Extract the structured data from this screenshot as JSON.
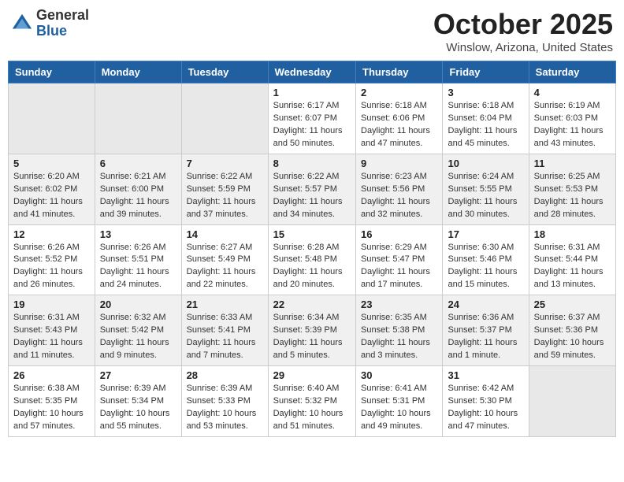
{
  "header": {
    "logo": {
      "general": "General",
      "blue": "Blue"
    },
    "title": "October 2025",
    "location": "Winslow, Arizona, United States"
  },
  "weekdays": [
    "Sunday",
    "Monday",
    "Tuesday",
    "Wednesday",
    "Thursday",
    "Friday",
    "Saturday"
  ],
  "weeks": [
    [
      {
        "day": "",
        "info": ""
      },
      {
        "day": "",
        "info": ""
      },
      {
        "day": "",
        "info": ""
      },
      {
        "day": "1",
        "info": "Sunrise: 6:17 AM\nSunset: 6:07 PM\nDaylight: 11 hours\nand 50 minutes."
      },
      {
        "day": "2",
        "info": "Sunrise: 6:18 AM\nSunset: 6:06 PM\nDaylight: 11 hours\nand 47 minutes."
      },
      {
        "day": "3",
        "info": "Sunrise: 6:18 AM\nSunset: 6:04 PM\nDaylight: 11 hours\nand 45 minutes."
      },
      {
        "day": "4",
        "info": "Sunrise: 6:19 AM\nSunset: 6:03 PM\nDaylight: 11 hours\nand 43 minutes."
      }
    ],
    [
      {
        "day": "5",
        "info": "Sunrise: 6:20 AM\nSunset: 6:02 PM\nDaylight: 11 hours\nand 41 minutes."
      },
      {
        "day": "6",
        "info": "Sunrise: 6:21 AM\nSunset: 6:00 PM\nDaylight: 11 hours\nand 39 minutes."
      },
      {
        "day": "7",
        "info": "Sunrise: 6:22 AM\nSunset: 5:59 PM\nDaylight: 11 hours\nand 37 minutes."
      },
      {
        "day": "8",
        "info": "Sunrise: 6:22 AM\nSunset: 5:57 PM\nDaylight: 11 hours\nand 34 minutes."
      },
      {
        "day": "9",
        "info": "Sunrise: 6:23 AM\nSunset: 5:56 PM\nDaylight: 11 hours\nand 32 minutes."
      },
      {
        "day": "10",
        "info": "Sunrise: 6:24 AM\nSunset: 5:55 PM\nDaylight: 11 hours\nand 30 minutes."
      },
      {
        "day": "11",
        "info": "Sunrise: 6:25 AM\nSunset: 5:53 PM\nDaylight: 11 hours\nand 28 minutes."
      }
    ],
    [
      {
        "day": "12",
        "info": "Sunrise: 6:26 AM\nSunset: 5:52 PM\nDaylight: 11 hours\nand 26 minutes."
      },
      {
        "day": "13",
        "info": "Sunrise: 6:26 AM\nSunset: 5:51 PM\nDaylight: 11 hours\nand 24 minutes."
      },
      {
        "day": "14",
        "info": "Sunrise: 6:27 AM\nSunset: 5:49 PM\nDaylight: 11 hours\nand 22 minutes."
      },
      {
        "day": "15",
        "info": "Sunrise: 6:28 AM\nSunset: 5:48 PM\nDaylight: 11 hours\nand 20 minutes."
      },
      {
        "day": "16",
        "info": "Sunrise: 6:29 AM\nSunset: 5:47 PM\nDaylight: 11 hours\nand 17 minutes."
      },
      {
        "day": "17",
        "info": "Sunrise: 6:30 AM\nSunset: 5:46 PM\nDaylight: 11 hours\nand 15 minutes."
      },
      {
        "day": "18",
        "info": "Sunrise: 6:31 AM\nSunset: 5:44 PM\nDaylight: 11 hours\nand 13 minutes."
      }
    ],
    [
      {
        "day": "19",
        "info": "Sunrise: 6:31 AM\nSunset: 5:43 PM\nDaylight: 11 hours\nand 11 minutes."
      },
      {
        "day": "20",
        "info": "Sunrise: 6:32 AM\nSunset: 5:42 PM\nDaylight: 11 hours\nand 9 minutes."
      },
      {
        "day": "21",
        "info": "Sunrise: 6:33 AM\nSunset: 5:41 PM\nDaylight: 11 hours\nand 7 minutes."
      },
      {
        "day": "22",
        "info": "Sunrise: 6:34 AM\nSunset: 5:39 PM\nDaylight: 11 hours\nand 5 minutes."
      },
      {
        "day": "23",
        "info": "Sunrise: 6:35 AM\nSunset: 5:38 PM\nDaylight: 11 hours\nand 3 minutes."
      },
      {
        "day": "24",
        "info": "Sunrise: 6:36 AM\nSunset: 5:37 PM\nDaylight: 11 hours\nand 1 minute."
      },
      {
        "day": "25",
        "info": "Sunrise: 6:37 AM\nSunset: 5:36 PM\nDaylight: 10 hours\nand 59 minutes."
      }
    ],
    [
      {
        "day": "26",
        "info": "Sunrise: 6:38 AM\nSunset: 5:35 PM\nDaylight: 10 hours\nand 57 minutes."
      },
      {
        "day": "27",
        "info": "Sunrise: 6:39 AM\nSunset: 5:34 PM\nDaylight: 10 hours\nand 55 minutes."
      },
      {
        "day": "28",
        "info": "Sunrise: 6:39 AM\nSunset: 5:33 PM\nDaylight: 10 hours\nand 53 minutes."
      },
      {
        "day": "29",
        "info": "Sunrise: 6:40 AM\nSunset: 5:32 PM\nDaylight: 10 hours\nand 51 minutes."
      },
      {
        "day": "30",
        "info": "Sunrise: 6:41 AM\nSunset: 5:31 PM\nDaylight: 10 hours\nand 49 minutes."
      },
      {
        "day": "31",
        "info": "Sunrise: 6:42 AM\nSunset: 5:30 PM\nDaylight: 10 hours\nand 47 minutes."
      },
      {
        "day": "",
        "info": ""
      }
    ]
  ]
}
